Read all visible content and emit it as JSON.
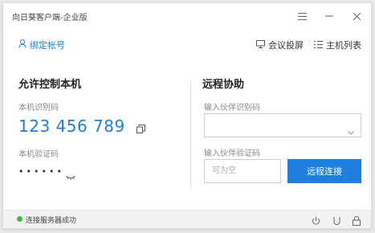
{
  "window": {
    "title": "向日葵客户端-企业版",
    "menu_icon": "hamburger-menu-icon",
    "minimize_icon": "minimize-icon",
    "close_icon": "close-icon"
  },
  "topbar": {
    "bind_account": {
      "label": "绑定帐号",
      "icon": "user-icon"
    },
    "meeting": {
      "label": "会议投屏",
      "icon": "monitor-icon"
    },
    "host_list": {
      "label": "主机列表",
      "icon": "list-icon"
    }
  },
  "allow_control": {
    "heading": "允许控制本机",
    "id_label": "本机识别码",
    "id_value": "123 456 789",
    "code_label": "本机验证码",
    "code_value": "••••••"
  },
  "remote_assist": {
    "heading": "远程协助",
    "partner_id_label": "输入伙伴识别码",
    "partner_code_label": "输入伙伴验证码",
    "partner_code_placeholder": "可为空",
    "connect_button": "远程连接"
  },
  "status": {
    "text": "连接服务器成功",
    "color": "#3ac03a"
  },
  "colors": {
    "accent": "#1e7fd8",
    "button": "#1e80dc"
  }
}
